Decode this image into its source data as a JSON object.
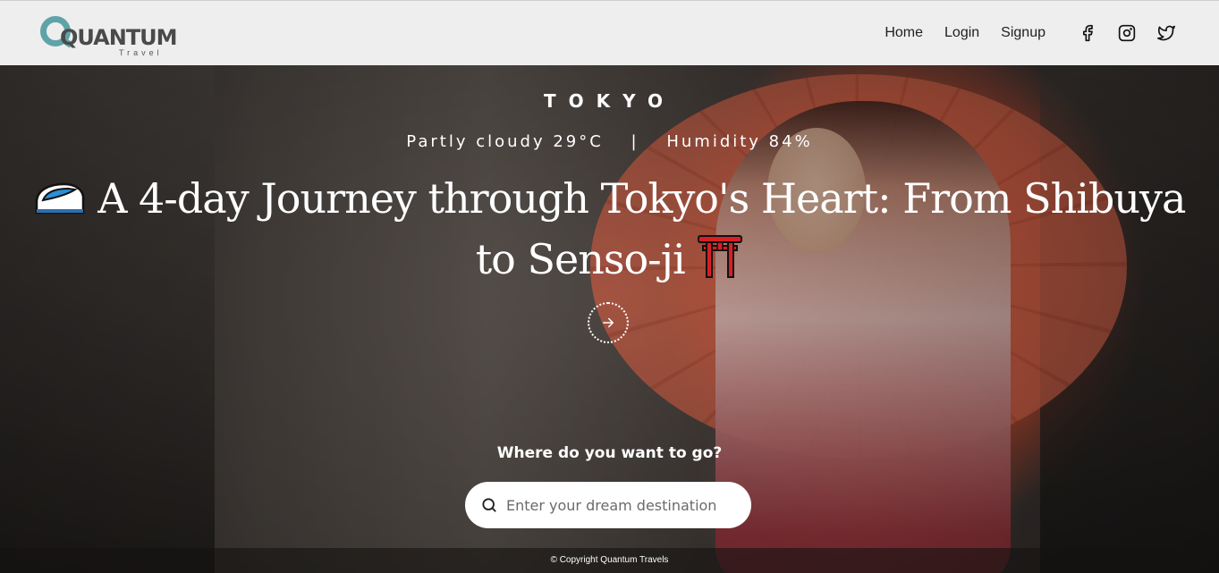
{
  "header": {
    "logo_text": "QUANTUM",
    "logo_sub": "Travel",
    "nav": [
      "Home",
      "Login",
      "Signup"
    ],
    "social_icons": [
      "facebook-icon",
      "instagram-icon",
      "twitter-icon"
    ]
  },
  "hero": {
    "city": "TOKYO",
    "weather": "Partly cloudy 29°C",
    "humidity": "Humidity 84%",
    "separator": "|",
    "headline": "A 4-day Journey through Tokyo's Heart: From Shibuya to Senso-ji",
    "emoji_leading": "🚄",
    "emoji_trailing": "⛩",
    "search_label": "Where do you want to go?",
    "search_placeholder": "Enter your dream destination"
  },
  "footer": {
    "copyright": "© Copyright Quantum Travels"
  },
  "colors": {
    "accent": "#5fa3a8",
    "header_bg": "#eeeeee"
  }
}
